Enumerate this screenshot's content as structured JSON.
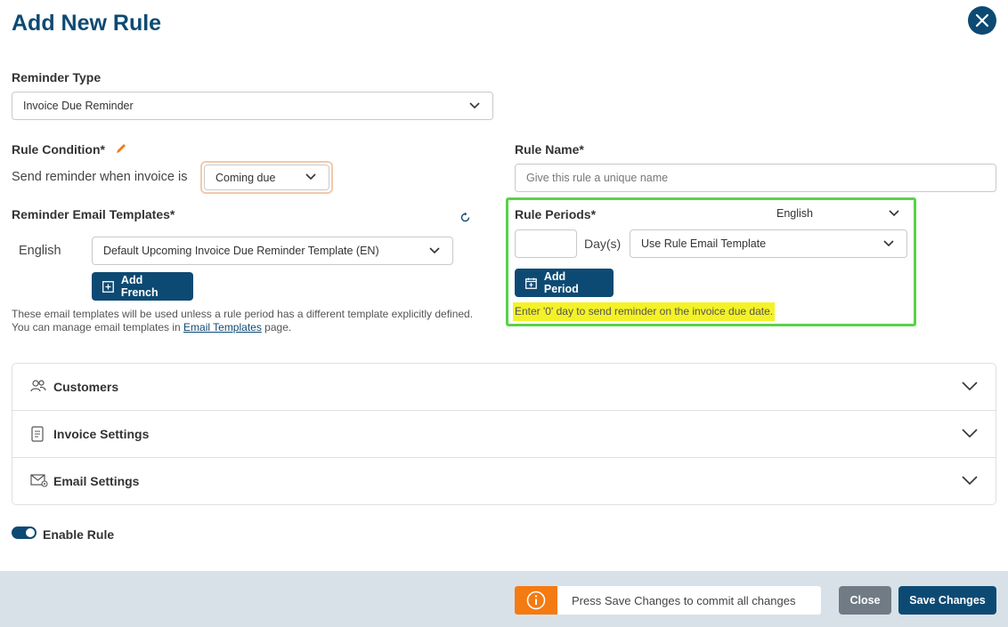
{
  "header": {
    "title": "Add New Rule",
    "close_icon": "close-icon"
  },
  "reminder_type": {
    "label": "Reminder Type",
    "value": "Invoice Due Reminder"
  },
  "rule_condition": {
    "label": "Rule Condition*",
    "sentence": "Send reminder when invoice is",
    "value": "Coming due",
    "highlight_color": "#f3c9ac"
  },
  "rule_name": {
    "label": "Rule Name*",
    "placeholder": "Give this rule a unique name",
    "value": ""
  },
  "email_templates": {
    "label": "Reminder Email Templates*",
    "language": "English",
    "template": "Default Upcoming Invoice Due Reminder Template (EN)",
    "add_button": "Add French",
    "note_before": "These email templates will be used unless a rule period has a different template explicitly defined. You can manage email templates in ",
    "note_link": "Email Templates",
    "note_after": " page."
  },
  "rule_periods": {
    "label": "Rule Periods*",
    "language": "English",
    "days_value": "",
    "days_label": "Day(s)",
    "template": "Use Rule Email Template",
    "add_button": "Add Period",
    "hint": "Enter '0' day to send reminder on the invoice due date.",
    "outline_color": "#5ad14a",
    "hint_bg": "#f4f227"
  },
  "sections": [
    {
      "label": "Customers",
      "icon": "users-icon"
    },
    {
      "label": "Invoice Settings",
      "icon": "document-icon"
    },
    {
      "label": "Email Settings",
      "icon": "email-settings-icon"
    }
  ],
  "enable_rule": {
    "label": "Enable Rule",
    "on": true
  },
  "footer": {
    "info_text": "Press Save Changes to commit all changes",
    "close_label": "Close",
    "save_label": "Save Changes"
  },
  "colors": {
    "primary": "#0d4a73",
    "warning": "#f47a12",
    "secondary": "#717b85"
  }
}
